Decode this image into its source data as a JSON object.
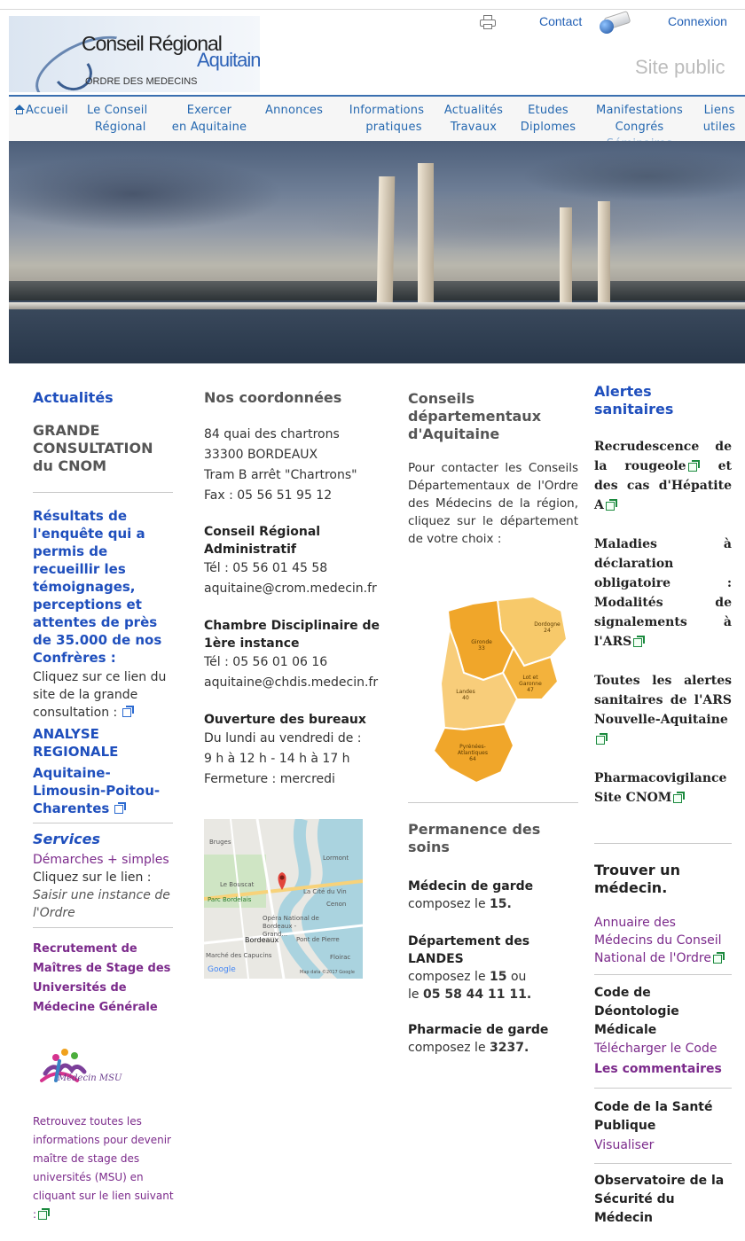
{
  "header": {
    "logo": {
      "line1": "Conseil Régional",
      "line2": "Aquitaine",
      "line3": "ORDRE DES MEDECINS"
    },
    "contact_label": "Contact",
    "login_label": "Connexion",
    "site_label": "Site public"
  },
  "nav": {
    "items": [
      {
        "line1": "Accueil",
        "line2": ""
      },
      {
        "line1": "Le Conseil",
        "line2": "Régional"
      },
      {
        "line1": "Exercer",
        "line2": "en Aquitaine"
      },
      {
        "line1": "Annonces",
        "line2": ""
      },
      {
        "line1": "Informations",
        "line2": "pratiques"
      },
      {
        "line1": "Actualités",
        "line2": "Travaux"
      },
      {
        "line1": "Etudes",
        "line2": "Diplomes"
      },
      {
        "line1": "Manifestations",
        "line2": "Congrés",
        "line3": "Séminaires"
      },
      {
        "line1": "Liens",
        "line2": "utiles"
      }
    ]
  },
  "actualites": {
    "title": "Actualités",
    "grande_consultation": "GRANDE CONSULTATION du CNOM",
    "resultats": "Résultats de l'enquête qui a permis de recueillir les témoignages, perceptions et attentes de près de 35.000 de nos Confrères :",
    "cliquez": "Cliquez sur ce lien du site de la grande consultation :",
    "analyse": "ANALYSE REGIONALE",
    "region": "Aquitaine-Limousin-Poitou-Charentes",
    "services_title": "Services",
    "demarches": "Démarches + simples",
    "cliquez_lien": "Cliquez sur le lien :",
    "saisir": "Saisir une instance de l'Ordre",
    "recrutement": "Recrutement de Maîtres de Stage des Universités de Médecine Générale",
    "msu_logo_text": "Médecin MSU",
    "retrouvez": "Retrouvez toutes les informations pour devenir maître de stage des universités (MSU) en cliquant sur le lien suivant :"
  },
  "coordonnees": {
    "title": "Nos coordonnées",
    "address_1": "84 quai des chartrons",
    "address_2": "33300 BORDEAUX",
    "address_3": "Tram B arrêt \"Chartrons\"",
    "fax": "Fax : 05 56 51 95 12",
    "admin_title": "Conseil Régional Administratif",
    "admin_tel": "Tél : 05 56 01 45 58",
    "admin_email": "aquitaine@crom.medecin.fr",
    "chambre_title": "Chambre Disciplinaire de 1ère instance",
    "chambre_tel": "Tél : 05 56 01 06 16",
    "chambre_email": "aquitaine@chdis.medecin.fr",
    "ouverture_title": "Ouverture des bureaux",
    "horaires_1": "Du lundi au vendredi de :",
    "horaires_2": "9 h à 12 h - 14 h à 17 h",
    "fermeture": "Fermeture : mercredi",
    "map_labels": [
      "Bruges",
      "Lormont",
      "Le Bouscat",
      "La Cité du Vin",
      "Parc Bordelais",
      "Cenon",
      "Opéra National de Bordeaux - Grand...",
      "Bordeaux",
      "Pont de Pierre",
      "Marché des Capucins",
      "Floirac",
      "Google",
      "Map data ©2017 Google"
    ]
  },
  "conseils": {
    "title": "Conseils départementaux d'Aquitaine",
    "intro": "Pour contacter les Conseils Départementaux de l'Ordre des Médecins de la région, cliquez sur le département de votre choix :",
    "departements": [
      {
        "name": "Dordogne",
        "num": "24"
      },
      {
        "name": "Gironde",
        "num": "33"
      },
      {
        "name": "Lot et Garonne",
        "num": "47"
      },
      {
        "name": "Landes",
        "num": "40"
      },
      {
        "name": "Pyrénées-Atlantiques",
        "num": "64"
      }
    ],
    "permanence_title": "Permanence des soins",
    "garde_title": "Médecin de garde",
    "garde_text": "composez le",
    "garde_num": "15.",
    "landes_title": "Département des LANDES",
    "landes_text": "composez le",
    "landes_num1": "15",
    "landes_ou": "ou",
    "landes_le": "le",
    "landes_num2": "05 58 44 11 11.",
    "pharmacie_title": "Pharmacie de garde",
    "pharmacie_text": "composez le",
    "pharmacie_num": "3237."
  },
  "alertes": {
    "title": "Alertes sanitaires",
    "rougeole": "Recrudescence de la rougeole",
    "et": "et",
    "hepatite": "des cas d'Hépatite A",
    "maladies": "Maladies à déclaration obligatoire : Modalités de signalements à l'ARS",
    "toutes": "Toutes les alertes sanitaires de l'ARS Nouvelle-Aquitaine",
    "pharmaco_1": "Pharmacovigilance",
    "pharmaco_2": "Site CNOM",
    "trouver_title": "Trouver un médecin.",
    "annuaire": "Annuaire des Médecins du Conseil National de l'Ordre",
    "code_title": "Code de Déontologie Médicale",
    "telecharger": "Télécharger le Code",
    "commentaires": "Les commentaires",
    "sante_title": "Code de la Santé Publique",
    "visualiser": "Visualiser",
    "observatoire": "Observatoire de la Sécurité du Médecin"
  }
}
